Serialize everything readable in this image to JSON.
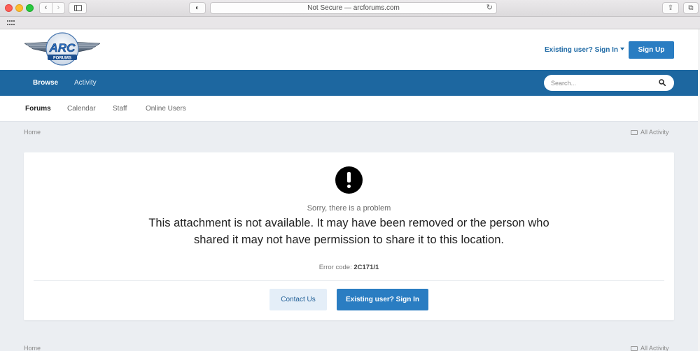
{
  "browser": {
    "url_text": "Not Secure — arcforums.com",
    "back_glyph": "‹",
    "forward_glyph": "›",
    "reload_glyph": "↻",
    "shield_glyph": "◐",
    "share_glyph": "⇪",
    "tabs_glyph": "⧉"
  },
  "header": {
    "logo_text": "ARC",
    "logo_subtext": "FORUMS",
    "signin_label": "Existing user? Sign In",
    "signup_label": "Sign Up"
  },
  "navbar": {
    "items": [
      {
        "label": "Browse",
        "active": true
      },
      {
        "label": "Activity",
        "active": false
      }
    ],
    "search_placeholder": "Search..."
  },
  "subnav": {
    "items": [
      {
        "label": "Forums",
        "active": true
      },
      {
        "label": "Calendar",
        "active": false
      },
      {
        "label": "Staff",
        "active": false
      },
      {
        "label": "Online Users",
        "active": false
      }
    ]
  },
  "breadcrumb": {
    "home": "Home",
    "all_activity": "All Activity"
  },
  "error": {
    "sorry": "Sorry, there is a problem",
    "message": "This attachment is not available. It may have been removed or the person who shared it may not have permission to share it to this location.",
    "code_label": "Error code:",
    "code": "2C171/1",
    "contact_label": "Contact Us",
    "signin_label": "Existing user? Sign In"
  },
  "colors": {
    "brand_blue": "#1d67a0",
    "button_blue": "#2a7dc2",
    "link_blue": "#1f6aa5"
  }
}
